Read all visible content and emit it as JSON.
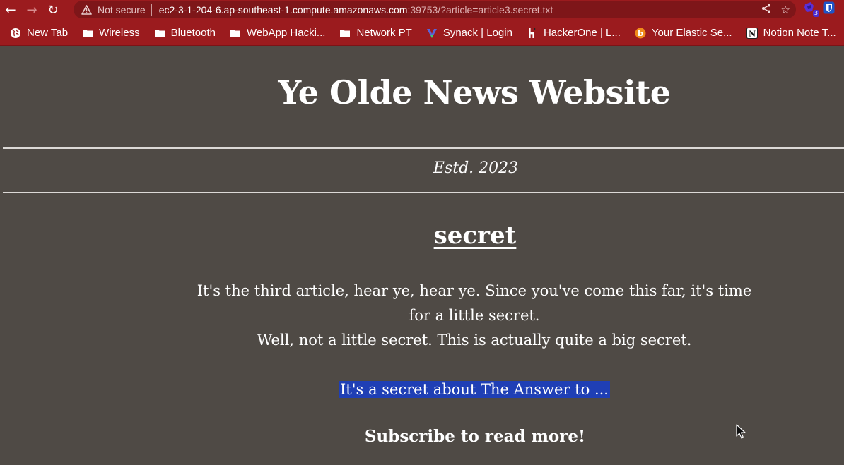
{
  "browser": {
    "security_label": "Not secure",
    "url_host": "ec2-3-1-204-6.ap-southeast-1.compute.amazonaws.com",
    "url_rest": ":39753/?article=article3.secret.txt",
    "extension_badge": "3",
    "accent_color": "#9b1b1e"
  },
  "bookmarks": [
    {
      "label": "New Tab",
      "icon": "globe-icon"
    },
    {
      "label": "Wireless",
      "icon": "folder-icon"
    },
    {
      "label": "Bluetooth",
      "icon": "folder-icon"
    },
    {
      "label": "WebApp Hacki...",
      "icon": "folder-icon"
    },
    {
      "label": "Network PT",
      "icon": "folder-icon"
    },
    {
      "label": "Synack | Login",
      "icon": "synack-icon"
    },
    {
      "label": "HackerOne | L...",
      "icon": "hackerone-icon"
    },
    {
      "label": "Your Elastic Se...",
      "icon": "elastic-icon"
    },
    {
      "label": "Notion Note T...",
      "icon": "notion-icon"
    }
  ],
  "site": {
    "title": "Ye Olde News Website",
    "established": "Estd. 2023"
  },
  "article": {
    "title": "secret",
    "line1": "It's the third article, hear ye, hear ye. Since you've come this far, it's time for a little secret.",
    "line2": "Well, not a little secret. This is actually quite a big secret.",
    "highlighted": "It's a secret about The Answer to ...",
    "cta": "Subscribe to read more!"
  }
}
